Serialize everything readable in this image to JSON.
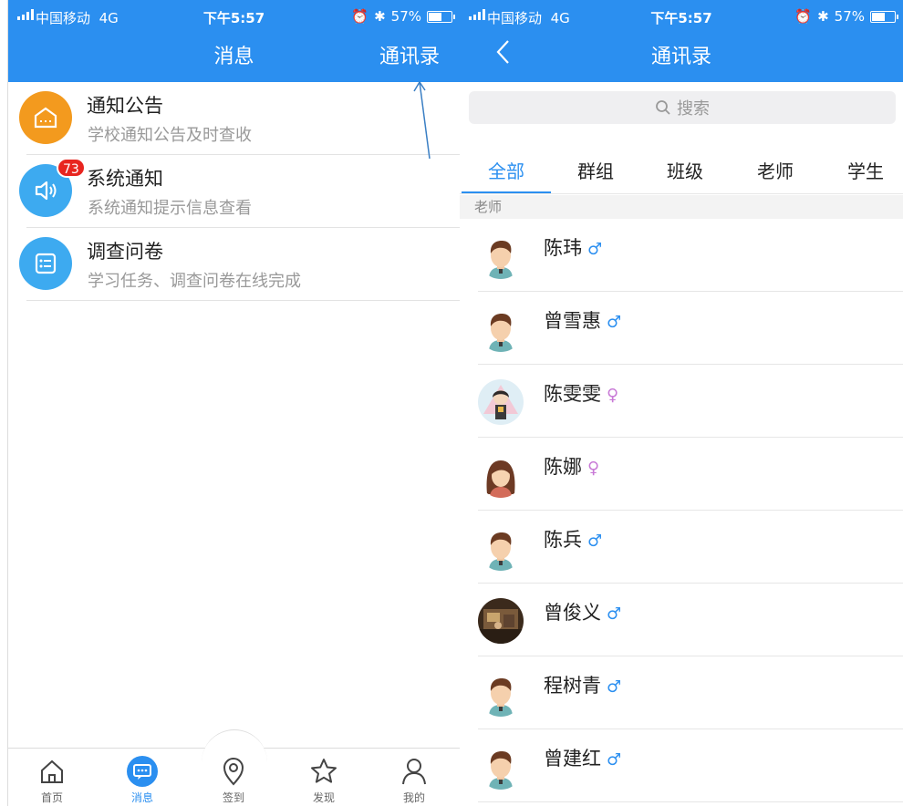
{
  "left": {
    "status": {
      "carrier": "中国移动",
      "network": "4G",
      "time": "下午5:57",
      "battery": "57%"
    },
    "nav": {
      "title": "消息",
      "action": "通讯录"
    },
    "messages": [
      {
        "title": "通知公告",
        "subtitle": "学校通知公告及时查收",
        "icon": "house-icon",
        "color": "#f39a1e"
      },
      {
        "title": "系统通知",
        "subtitle": "系统通知提示信息查看",
        "icon": "speaker-icon",
        "color": "#3daaf0",
        "badge": "73"
      },
      {
        "title": "调查问卷",
        "subtitle": "学习任务、调查问卷在线完成",
        "icon": "checklist-icon",
        "color": "#3daaf0"
      }
    ],
    "tabs": [
      {
        "label": "首页",
        "icon": "home-icon"
      },
      {
        "label": "消息",
        "icon": "chat-icon",
        "active": true
      },
      {
        "label": "签到",
        "icon": "location-pin-icon"
      },
      {
        "label": "发现",
        "icon": "star-icon"
      },
      {
        "label": "我的",
        "icon": "person-icon"
      }
    ]
  },
  "right": {
    "status": {
      "carrier": "中国移动",
      "network": "4G",
      "time": "下午5:57",
      "battery": "57%"
    },
    "nav": {
      "title": "通讯录"
    },
    "search_placeholder": "搜索",
    "segments": [
      "全部",
      "群组",
      "班级",
      "老师",
      "学生"
    ],
    "active_segment": "全部",
    "section": "老师",
    "contacts": [
      {
        "name": "陈玮",
        "sex": "♂"
      },
      {
        "name": "曾雪惠",
        "sex": "♂"
      },
      {
        "name": "陈雯雯",
        "sex": "♀"
      },
      {
        "name": "陈娜",
        "sex": "♀"
      },
      {
        "name": "陈兵",
        "sex": "♂"
      },
      {
        "name": "曾俊义",
        "sex": "♂"
      },
      {
        "name": "程树青",
        "sex": "♂"
      },
      {
        "name": "曾建红",
        "sex": "♂"
      }
    ]
  },
  "colors": {
    "primary": "#2b8ff0",
    "badge": "#e8251f",
    "orange": "#f39a1e"
  }
}
